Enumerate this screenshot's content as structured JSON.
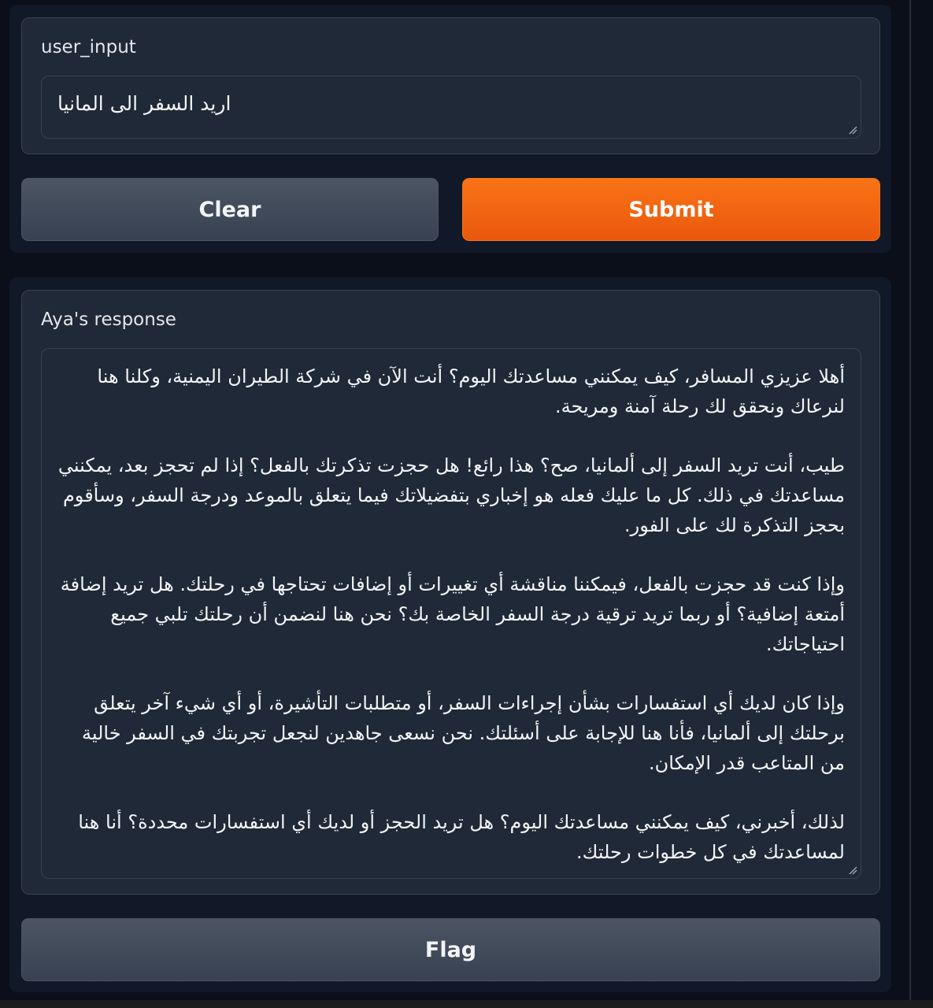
{
  "input": {
    "label": "user_input",
    "value": "اريد السفر الى المانيا"
  },
  "buttons": {
    "clear": "Clear",
    "submit": "Submit",
    "flag": "Flag"
  },
  "output": {
    "label": "Aya's response",
    "paragraphs": [
      "أهلا عزيزي المسافر، كيف يمكنني مساعدتك اليوم؟ أنت الآن في شركة الطيران اليمنية، وكلنا هنا لنرعاك ونحقق لك رحلة آمنة ومريحة.",
      "طيب، أنت تريد السفر إلى ألمانيا، صح؟ هذا رائع! هل حجزت تذكرتك بالفعل؟ إذا لم تحجز بعد، يمكنني مساعدتك في ذلك. كل ما عليك فعله هو إخباري بتفضيلاتك فيما يتعلق بالموعد ودرجة السفر، وسأقوم بحجز التذكرة لك على الفور.",
      "وإذا كنت قد حجزت بالفعل، فيمكننا مناقشة أي تغييرات أو إضافات تحتاجها في رحلتك. هل تريد إضافة أمتعة إضافية؟ أو ربما تريد ترقية درجة السفر الخاصة بك؟ نحن هنا لنضمن أن رحلتك تلبي جميع احتياجاتك.",
      "وإذا كان لديك أي استفسارات بشأن إجراءات السفر، أو متطلبات التأشيرة، أو أي شيء آخر يتعلق برحلتك إلى ألمانيا، فأنا هنا للإجابة على أسئلتك. نحن نسعى جاهدين لنجعل تجربتك في السفر خالية من المتاعب قدر الإمكان.",
      "لذلك، أخبرني، كيف يمكنني مساعدتك اليوم؟ هل تريد الحجز أو لديك أي استفسارات محددة؟ أنا هنا لمساعدتك في كل خطوات رحلتك."
    ]
  },
  "colors": {
    "submit": "#f97316",
    "secondary": "#4b5563",
    "panel": "#111827",
    "block": "#1f2937"
  }
}
